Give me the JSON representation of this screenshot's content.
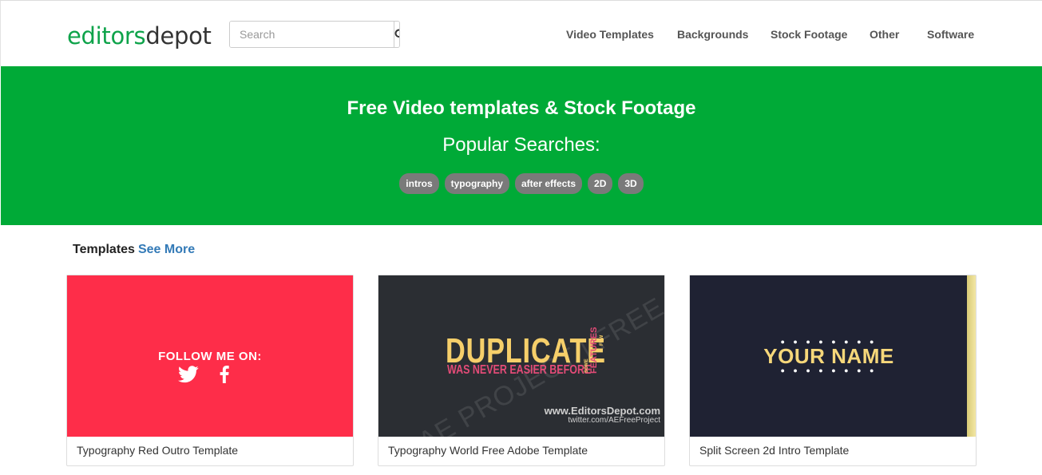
{
  "header": {
    "logo_part1": "editors",
    "logo_part2": "depot",
    "search_placeholder": "Search",
    "nav": [
      "Video Templates",
      "Backgrounds",
      "Stock Footage",
      "Other",
      "Software"
    ]
  },
  "hero": {
    "title": "Free Video templates & Stock Footage",
    "subtitle": "Popular Searches:",
    "chips": [
      "intros",
      "typography",
      "after effects",
      "2D",
      "3D"
    ]
  },
  "section": {
    "title": "Templates",
    "see_more": "See More"
  },
  "cards": [
    {
      "caption": "Typography Red Outro Template",
      "thumb_text": "FOLLOW ME ON:"
    },
    {
      "caption": "Typography World Free Adobe Template",
      "thumb_main": "DUPLICATE",
      "thumb_sub": "WAS NEVER EASIER BEFORE",
      "thumb_side": "FEATURES",
      "thumb_side_small": "SOME",
      "thumb_side_small2": "FEW",
      "watermark": "AE PROJECT | FREE",
      "site": "www.EditorsDepot.com",
      "twitter": "twitter.com/AEFreeProject"
    },
    {
      "caption": "Split Screen 2d Intro Template",
      "thumb_text": "YOUR NAME"
    }
  ],
  "colors": {
    "brand_green": "#00aa37",
    "logo_green": "#0ea34a",
    "chip_gray": "#7a7a7a",
    "link_blue": "#337ab7"
  }
}
